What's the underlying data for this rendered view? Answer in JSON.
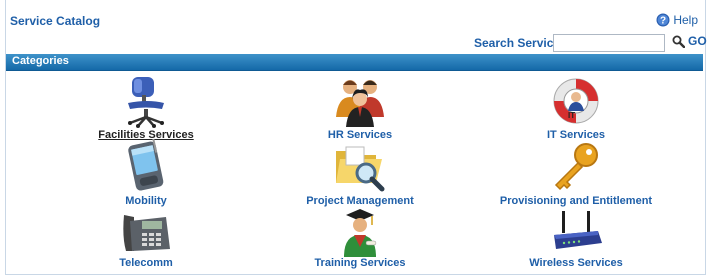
{
  "header": {
    "title": "Service Catalog",
    "help_label": "Help",
    "help_icon": "help-icon"
  },
  "search": {
    "label": "Search Services",
    "value": "",
    "go_label": "GO",
    "go_icon": "magnifier-icon"
  },
  "categories": {
    "heading": "Categories",
    "items": [
      {
        "label": "Facilities Services",
        "icon": "office-chair-icon",
        "selected": true
      },
      {
        "label": "HR Services",
        "icon": "people-icon",
        "selected": false
      },
      {
        "label": "IT Services",
        "icon": "life-buoy-icon",
        "selected": false
      },
      {
        "label": "Mobility",
        "icon": "pda-icon",
        "selected": false
      },
      {
        "label": "Project Management",
        "icon": "folder-search-icon",
        "selected": false
      },
      {
        "label": "Provisioning and Entitlement",
        "icon": "key-icon",
        "selected": false
      },
      {
        "label": "Telecomm",
        "icon": "desk-phone-icon",
        "selected": false
      },
      {
        "label": "Training Services",
        "icon": "graduate-icon",
        "selected": false
      },
      {
        "label": "Wireless Services",
        "icon": "router-icon",
        "selected": false
      }
    ]
  },
  "colors": {
    "link": "#1f5fa8",
    "bar_top": "#3e92c9",
    "bar_bottom": "#1469a8",
    "active_label": "#222222"
  }
}
